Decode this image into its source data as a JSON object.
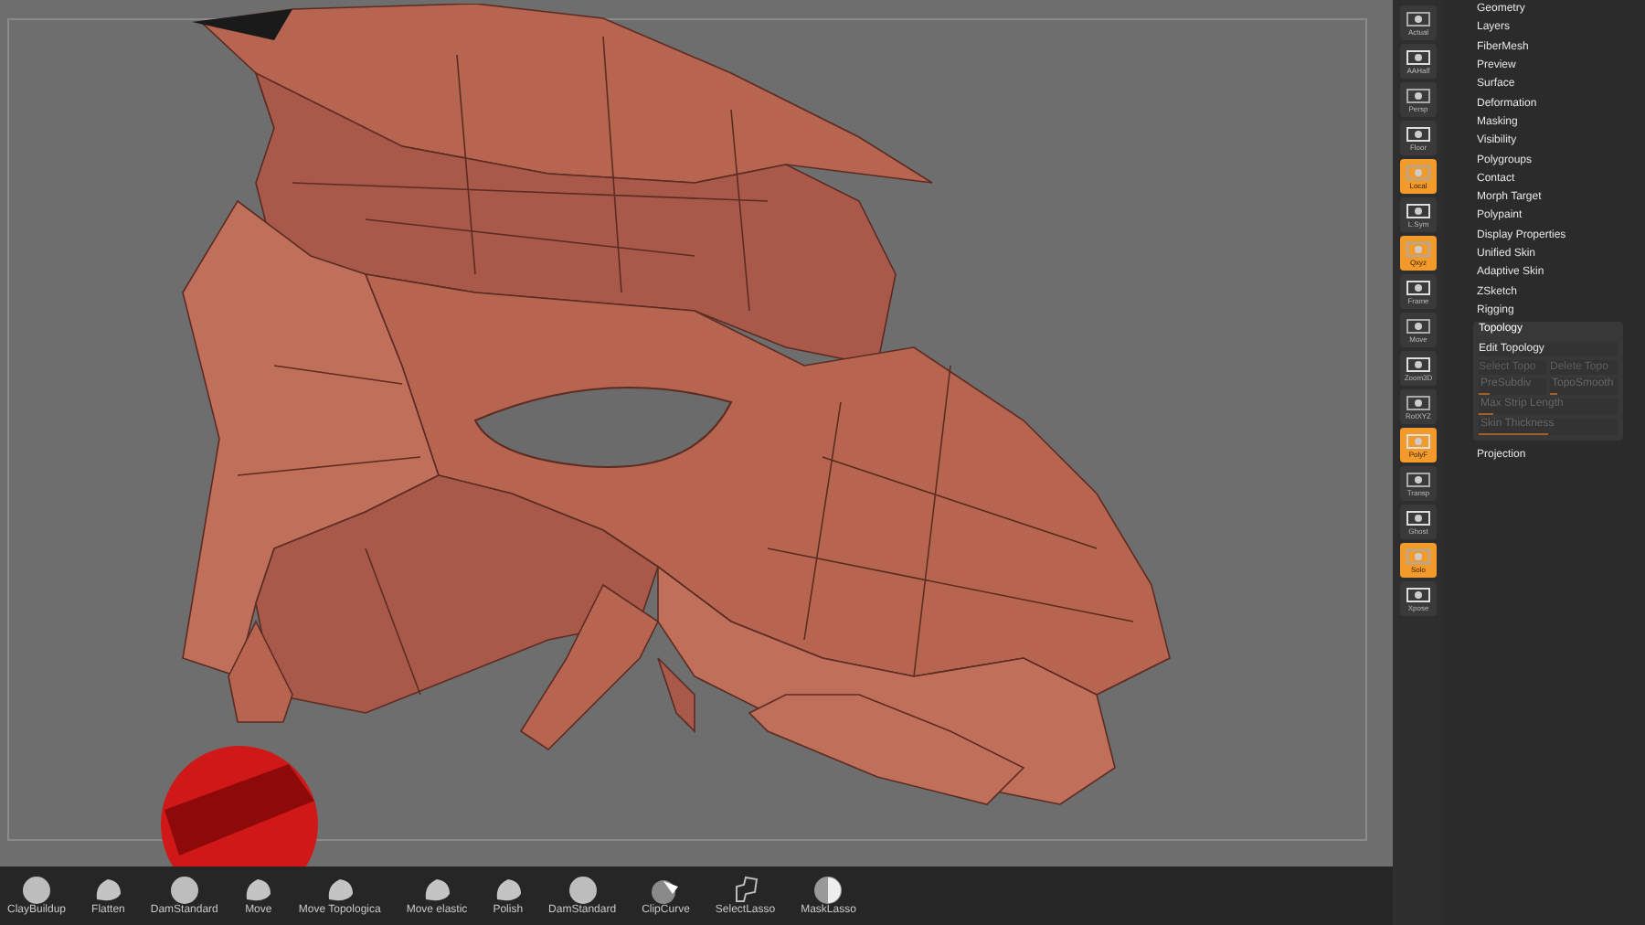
{
  "viewport_tools": [
    {
      "label": "Actual",
      "on": false
    },
    {
      "label": "AAHalf",
      "on": false
    },
    {
      "label": "Persp",
      "on": false
    },
    {
      "label": "Floor",
      "on": false
    },
    {
      "label": "Local",
      "on": true
    },
    {
      "label": "L.Sym",
      "on": false
    },
    {
      "label": "Qxyz",
      "on": true
    },
    {
      "label": "Frame",
      "on": false
    },
    {
      "label": "Move",
      "on": false
    },
    {
      "label": "Zoom3D",
      "on": false
    },
    {
      "label": "RotXYZ",
      "on": false
    },
    {
      "label": "PolyF",
      "on": true
    },
    {
      "label": "Transp",
      "on": false
    },
    {
      "label": "Ghost",
      "on": false
    },
    {
      "label": "Solo",
      "on": true
    },
    {
      "label": "Xpose",
      "on": false
    }
  ],
  "menu": {
    "items": [
      "Geometry",
      "Layers",
      "FiberMesh",
      "Preview",
      "Surface",
      "Deformation",
      "Masking",
      "Visibility",
      "Polygroups",
      "Contact",
      "Morph Target",
      "Polypaint",
      "Display Properties",
      "Unified Skin",
      "Adaptive Skin",
      "ZSketch",
      "Rigging"
    ],
    "topology": {
      "title": "Topology",
      "expanded": true,
      "edit_button": "Edit Topology",
      "buttons": [
        {
          "label": "Select Topo",
          "disabled": true
        },
        {
          "label": "Delete Topo",
          "disabled": true
        }
      ],
      "sliders": [
        {
          "label": "PreSubdiv",
          "level": 0.15,
          "disabled": true
        },
        {
          "label": "TopoSmooth",
          "level": 0.1,
          "disabled": true
        },
        {
          "label": "Max Strip Length",
          "level": 0.1,
          "disabled": true
        },
        {
          "label": "Skin Thickness",
          "level": 0.5,
          "disabled": true
        }
      ]
    },
    "after": [
      "Projection"
    ]
  },
  "shelf": [
    {
      "label": "ClayBuildup",
      "kind": "sphere"
    },
    {
      "label": "Flatten",
      "kind": "blob"
    },
    {
      "label": "DamStandard",
      "kind": "sphere"
    },
    {
      "label": "Move",
      "kind": "blob"
    },
    {
      "label": "Move Topologica",
      "kind": "blob"
    },
    {
      "label": "Move elastic",
      "kind": "blob"
    },
    {
      "label": "Polish",
      "kind": "blob"
    },
    {
      "label": "DamStandard",
      "kind": "sphere"
    },
    {
      "label": "ClipCurve",
      "kind": "clip"
    },
    {
      "label": "SelectLasso",
      "kind": "lasso"
    },
    {
      "label": "MaskLasso",
      "kind": "mask"
    }
  ]
}
